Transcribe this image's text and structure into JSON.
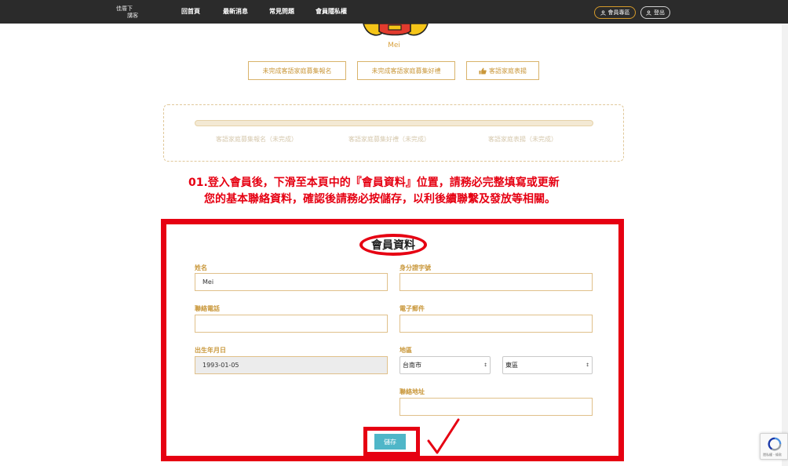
{
  "header": {
    "logo_line1": "佳厝下",
    "logo_line2": "講客",
    "nav": [
      "回首頁",
      "最新消息",
      "常見問題",
      "會員隱私權"
    ],
    "member_button": "會員專區",
    "logout_button": "登出"
  },
  "profile": {
    "username": "Mei",
    "buttons": [
      "未完成客語家庭募集報名",
      "未完成客語家庭募集好禮",
      "客語家庭表揚"
    ]
  },
  "progress": {
    "value": 0,
    "labels": [
      "客語家庭募集報名（未完成）",
      "客語家庭募集好禮（未完成）",
      "客語家庭表揚（未完成）"
    ]
  },
  "instruction": {
    "line1": "01.登入會員後，下滑至本頁中的『會員資料』位置，請務必完整填寫或更新",
    "line2": "您的基本聯絡資料，確認後請務必按儲存，以利後續聯繫及發放等相關。"
  },
  "form": {
    "title": "會員資料",
    "name_label": "姓名",
    "name_value": "Mei",
    "id_label": "身分證字號",
    "id_value": "",
    "phone_label": "聯絡電話",
    "phone_value": "",
    "email_label": "電子郵件",
    "email_value": "",
    "birthday_label": "出生年月日",
    "birthday_value": "1993-01-05",
    "region_label": "地區",
    "city_value": "台南市",
    "district_value": "東區",
    "address_label": "聯絡地址",
    "address_value": "",
    "save_button": "儲存"
  },
  "recaptcha": {
    "text": "隱私權 - 條款"
  },
  "colors": {
    "topbar": "#2b2b2b",
    "gold": "#c9973a",
    "annotation_red": "#e60012",
    "save_button": "#4fb6c8"
  }
}
